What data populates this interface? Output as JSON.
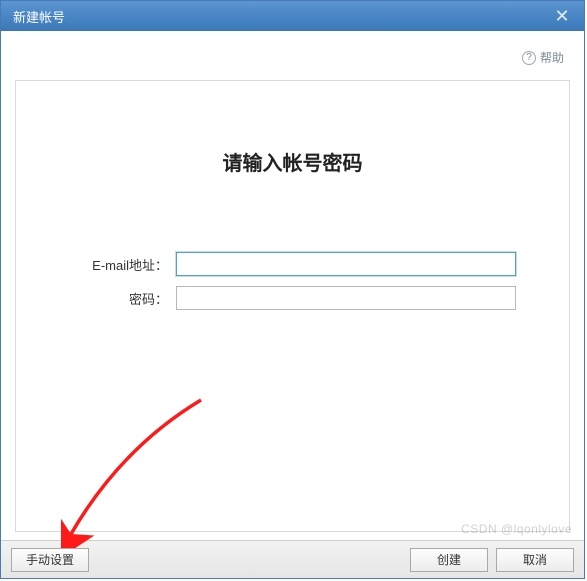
{
  "window": {
    "title": "新建帐号"
  },
  "help": {
    "label": "帮助"
  },
  "content": {
    "heading": "请输入帐号密码"
  },
  "form": {
    "email_label": "E-mail地址：",
    "email_value": "",
    "password_label": "密码：",
    "password_value": ""
  },
  "footer": {
    "manual_label": "手动设置",
    "create_label": "创建",
    "cancel_label": "取消"
  },
  "watermark": {
    "text": "CSDN @lqonlylove"
  }
}
